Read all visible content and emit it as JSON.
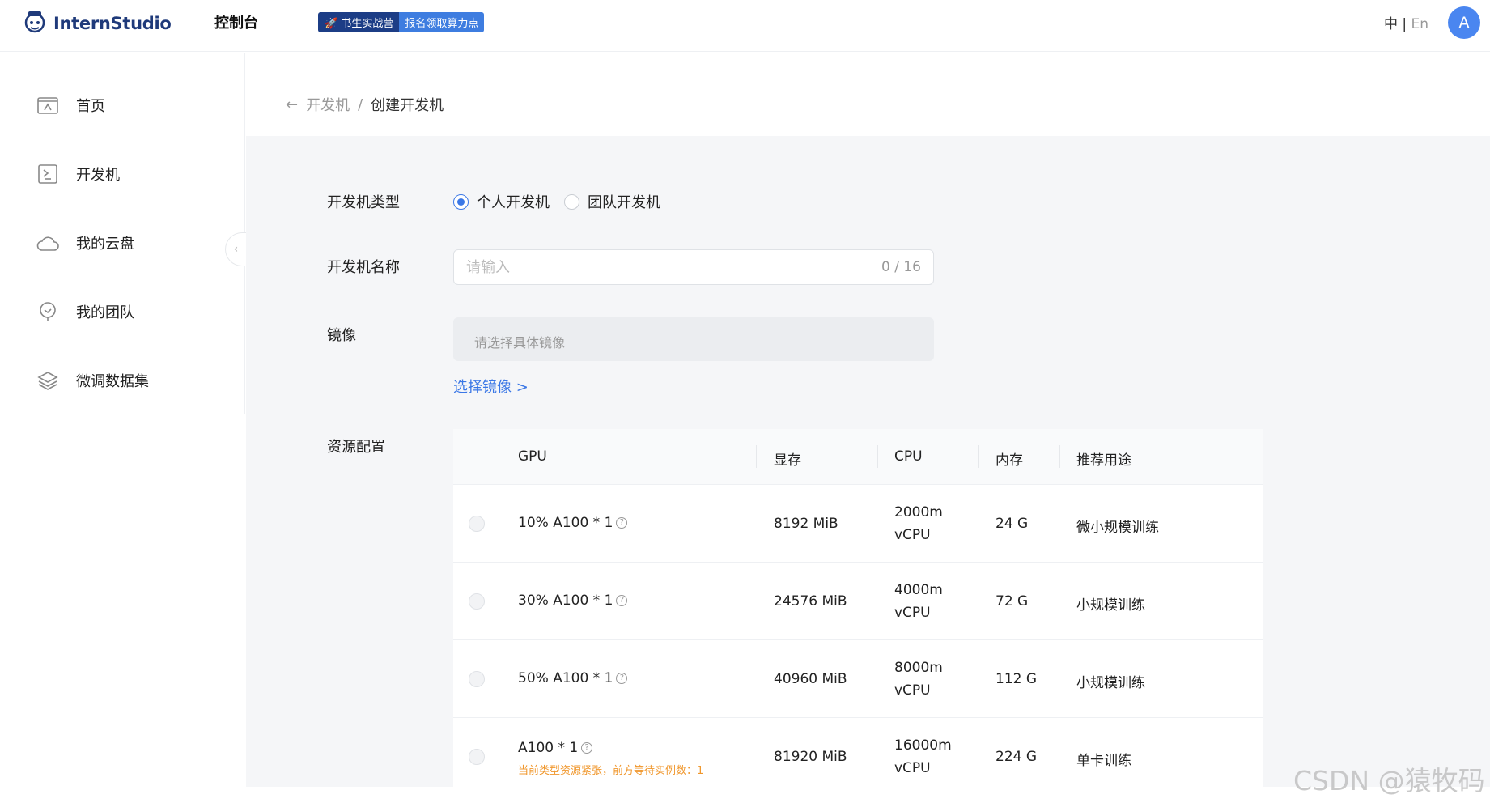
{
  "header": {
    "logo_text": "InternStudio",
    "console_label": "控制台",
    "promo_left": "🚀 书生实战营",
    "promo_right": "报名领取算力点",
    "lang_zh": "中",
    "lang_sep": "|",
    "lang_en": "En",
    "avatar_initial": "A"
  },
  "sidebar": {
    "items": [
      {
        "label": "首页",
        "icon": "home-icon"
      },
      {
        "label": "开发机",
        "icon": "terminal-icon"
      },
      {
        "label": "我的云盘",
        "icon": "cloud-icon"
      },
      {
        "label": "我的团队",
        "icon": "team-icon"
      },
      {
        "label": "微调数据集",
        "icon": "layers-icon"
      }
    ]
  },
  "breadcrumb": {
    "back": "←",
    "parent": "开发机",
    "sep": "/",
    "current": "创建开发机"
  },
  "form": {
    "type_label": "开发机类型",
    "type_options": [
      "个人开发机",
      "团队开发机"
    ],
    "selected_type": "个人开发机",
    "name_label": "开发机名称",
    "name_placeholder": "请输入",
    "name_value": "",
    "name_counter": "0 / 16",
    "image_label": "镜像",
    "image_placeholder": "请选择具体镜像",
    "image_link": "选择镜像 >",
    "resource_label": "资源配置"
  },
  "resource_table": {
    "headers": [
      "GPU",
      "显存",
      "CPU",
      "内存",
      "推荐用途"
    ],
    "rows": [
      {
        "gpu": "10% A100 * 1",
        "vram": "8192 MiB",
        "cpu_line1": "2000m",
        "cpu_line2": "vCPU",
        "mem": "24 G",
        "usage": "微小规模训练",
        "warning": ""
      },
      {
        "gpu": "30% A100 * 1",
        "vram": "24576 MiB",
        "cpu_line1": "4000m",
        "cpu_line2": "vCPU",
        "mem": "72 G",
        "usage": "小规模训练",
        "warning": ""
      },
      {
        "gpu": "50% A100 * 1",
        "vram": "40960 MiB",
        "cpu_line1": "8000m",
        "cpu_line2": "vCPU",
        "mem": "112 G",
        "usage": "小规模训练",
        "warning": ""
      },
      {
        "gpu": "A100 * 1",
        "vram": "81920 MiB",
        "cpu_line1": "16000m",
        "cpu_line2": "vCPU",
        "mem": "224 G",
        "usage": "单卡训练",
        "warning": "当前类型资源紧张，前方等待实例数：1"
      }
    ]
  },
  "watermark": "CSDN @猿牧码",
  "colors": {
    "accent": "#3a77e6",
    "brand": "#1f3a7a",
    "warning": "#f0972c",
    "content_bg": "#f5f6f8"
  }
}
